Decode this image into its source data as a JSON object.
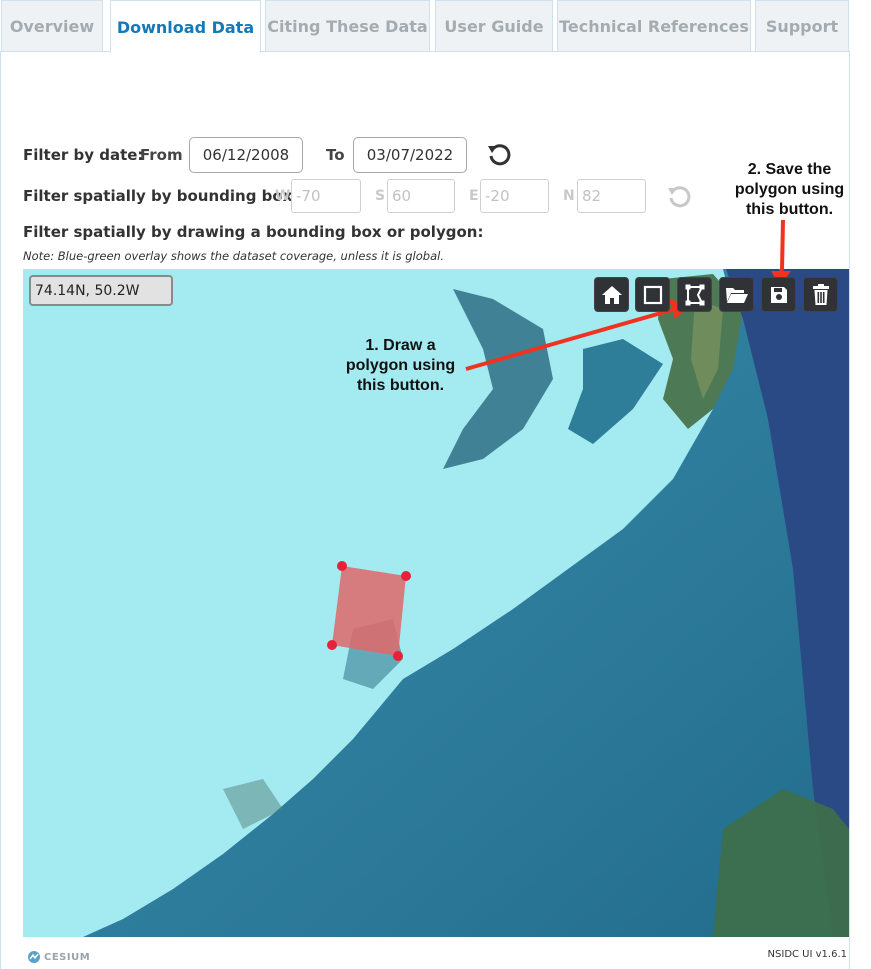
{
  "tabs": [
    {
      "label": "Overview"
    },
    {
      "label": "Download Data"
    },
    {
      "label": "Citing These Data"
    },
    {
      "label": "User Guide"
    },
    {
      "label": "Technical References"
    },
    {
      "label": "Support"
    }
  ],
  "date_filter": {
    "label": "Filter by date:",
    "from_label": "From",
    "from_value": "06/12/2008",
    "to_label": "To",
    "to_value": "03/07/2022"
  },
  "bbox_filter": {
    "label": "Filter spatially by bounding box:",
    "w_label": "W",
    "w_placeholder": "-70",
    "s_label": "S",
    "s_placeholder": "60",
    "e_label": "E",
    "e_placeholder": "-20",
    "n_label": "N",
    "n_placeholder": "82"
  },
  "draw_filter": {
    "label": "Filter spatially by drawing a bounding box or polygon:",
    "note": "Note: Blue-green overlay shows the dataset coverage, unless it is global."
  },
  "map": {
    "coordinates": "74.14N, 50.2W",
    "tools": [
      "home-icon",
      "rectangle-icon",
      "polygon-icon",
      "folder-open-icon",
      "save-icon",
      "trash-icon"
    ],
    "callout_1": [
      "1. Draw a",
      "polygon using",
      "this button."
    ],
    "callout_2": [
      "2. Save the",
      "polygon using",
      "this button."
    ],
    "polygon_color": "#e0686a",
    "vertex_color": "#e8203a",
    "arrow_color": "#f0321f"
  },
  "footer": {
    "cesium": "CESIUM",
    "version": "NSIDC UI v1.6.1"
  },
  "colors": {
    "active_tab": "#1479b8",
    "ice": "#9fe7ef",
    "ocean": "#2c7a9a",
    "outside_coverage": "#2a4a86"
  }
}
